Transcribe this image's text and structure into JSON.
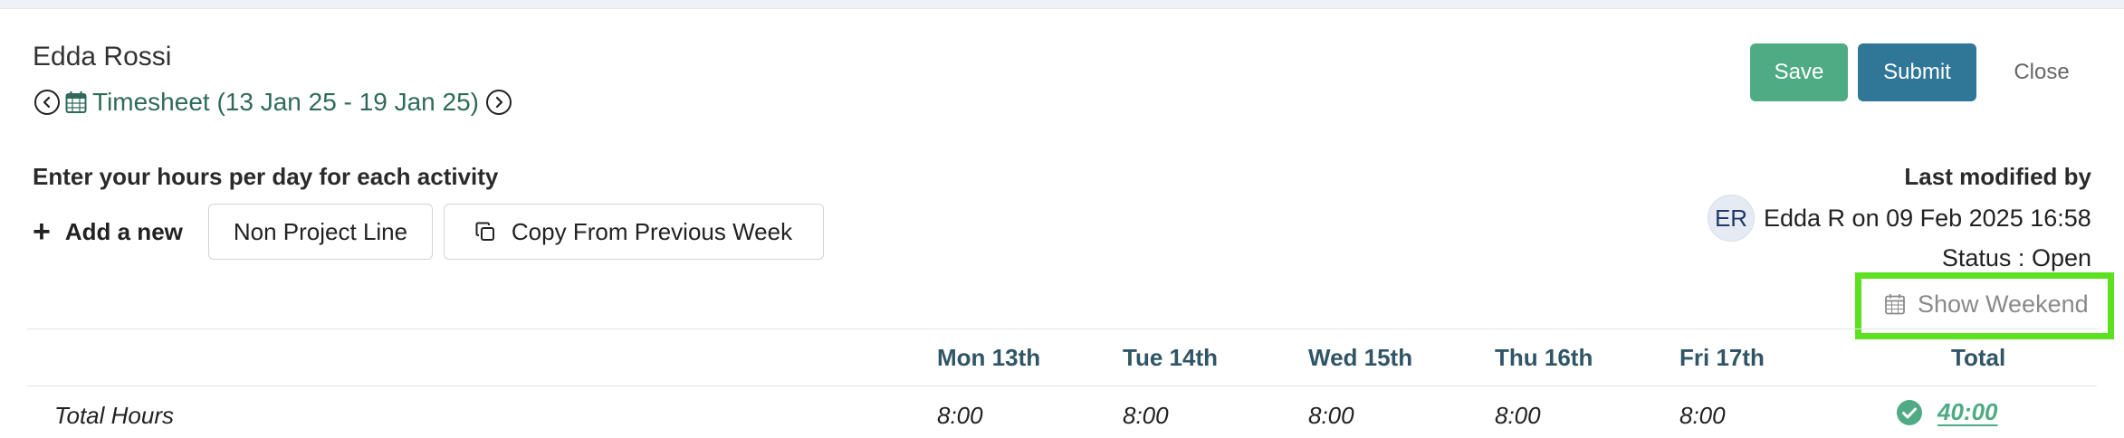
{
  "header": {
    "user_name": "Edda Rossi",
    "timesheet_title": "Timesheet (13 Jan 25 - 19 Jan 25)"
  },
  "actions": {
    "save_label": "Save",
    "submit_label": "Submit",
    "close_label": "Close"
  },
  "instructions": "Enter your hours per day for each activity",
  "add_new": {
    "label": "Add a new",
    "non_project_line_label": "Non Project Line",
    "copy_previous_label": "Copy From Previous Week"
  },
  "modified": {
    "label": "Last modified by",
    "avatar_initials": "ER",
    "text": "Edda R on 09 Feb 2025 16:58",
    "status": "Status : Open"
  },
  "weekend_toggle_label": "Show Weekend",
  "table": {
    "columns": [
      "Mon 13th",
      "Tue 14th",
      "Wed 15th",
      "Thu 16th",
      "Fri 17th",
      "Total"
    ],
    "total_row": {
      "label": "Total Hours",
      "values": [
        "8:00",
        "8:00",
        "8:00",
        "8:00",
        "8:00"
      ],
      "total": "40:00"
    }
  },
  "colors": {
    "save": "#4eab84",
    "submit": "#2f7697",
    "title_green": "#2f6b5a",
    "highlight": "#5ce01f"
  },
  "icons": {
    "prev": "chevron-left-circle-icon",
    "next": "chevron-right-circle-icon",
    "calendar": "calendar-icon",
    "plus": "plus-icon",
    "copy": "copy-icon",
    "check": "check-circle-icon"
  }
}
